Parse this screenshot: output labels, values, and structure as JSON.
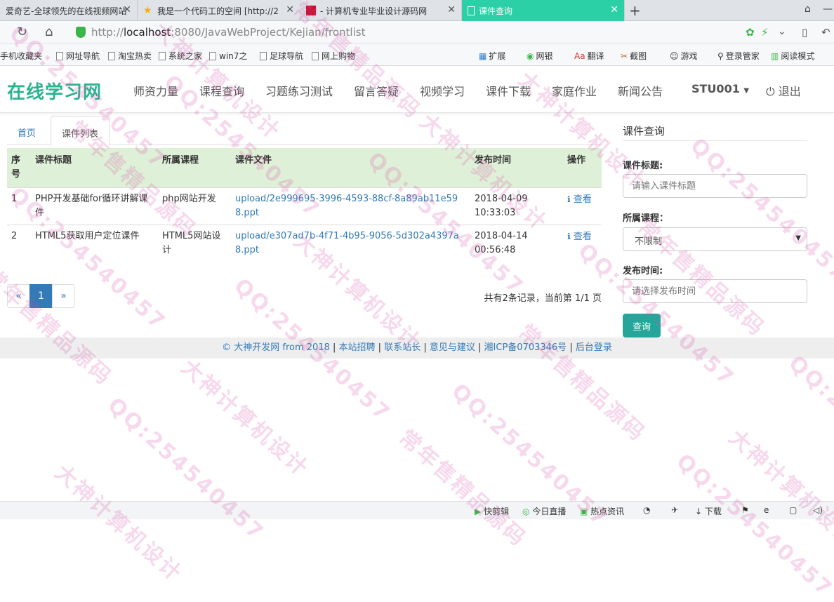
{
  "browser": {
    "tabs": [
      {
        "label": "爱奇艺-全球领先的在线视频网站"
      },
      {
        "label": "我是一个代码工的空间 [http://2"
      },
      {
        "label": "- 计算机专业毕业设计源码网"
      },
      {
        "label": "课件查询"
      }
    ],
    "url_prefix": "http://",
    "url_host": "localhost",
    "url_rest": ":8080/JavaWebProject/Kejian/frontlist",
    "bookmarks": [
      "手机收藏夹",
      "网址导航",
      "淘宝热卖",
      "系统之家",
      "win7之",
      "足球导航",
      "网上购物"
    ],
    "extensions": [
      "扩展",
      "网银",
      "翻译",
      "截图",
      "游戏",
      "登录管家",
      "阅读模式"
    ]
  },
  "site": {
    "logo": "在线学习网",
    "nav": [
      "师资力量",
      "课程查询",
      "习题练习测试",
      "留言答疑",
      "视频学习",
      "课件下载",
      "家庭作业",
      "新闻公告"
    ],
    "user": "STU001",
    "logout": "退出"
  },
  "content": {
    "tabs": [
      "首页",
      "课件列表"
    ],
    "table": {
      "headers": [
        "序号",
        "课件标题",
        "所属课程",
        "课件文件",
        "发布时间",
        "操作"
      ],
      "rows": [
        {
          "no": "1",
          "title": "PHP开发基础for循环讲解课件",
          "course": "php网站开发",
          "file": "upload/2e999695-3996-4593-88cf-8a89ab11e598.ppt",
          "time": "2018-04-09 10:33:03",
          "action": "查看"
        },
        {
          "no": "2",
          "title": "HTML5获取用户定位课件",
          "course": "HTML5网站设计",
          "file": "upload/e307ad7b-4f71-4b95-9056-5d302a4397a8.ppt",
          "time": "2018-04-14 00:56:48",
          "action": "查看"
        }
      ]
    },
    "pager": {
      "prev": "«",
      "current": "1",
      "next": "»",
      "info": "共有2条记录，当前第 1/1 页"
    }
  },
  "sidebar": {
    "title": "课件查询",
    "title_label": "课件标题:",
    "title_placeholder": "请输入课件标题",
    "course_label": "所属课程：",
    "course_value": "不限制",
    "time_label": "发布时间:",
    "time_placeholder": "请选择发布时间",
    "query_button": "查询"
  },
  "footer": {
    "copyright": "© 大神开发网 from 2018",
    "links": [
      "本站招聘",
      "联系站长",
      "意见与建议",
      "湘ICP备0703346号",
      "后台登录"
    ]
  },
  "statusbar": [
    "快剪辑",
    "今日直播",
    "热点资讯",
    "下载"
  ],
  "watermarks": [
    "QQ:254540457",
    "大神计算机设计",
    "常年售精品源码"
  ],
  "colors": {
    "accent": "#2bb391",
    "active_tab": "#2bd0a6",
    "link": "#337ab7",
    "header_row": "#dff0d8",
    "button": "#26a69a"
  }
}
